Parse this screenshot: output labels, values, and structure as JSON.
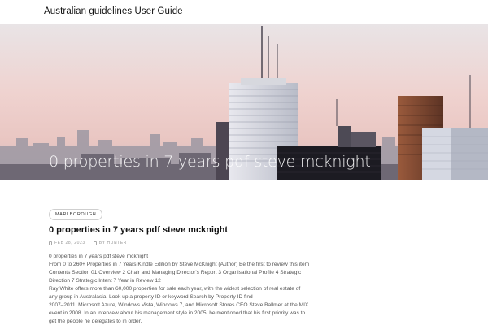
{
  "header": {
    "site_title": "Australian guidelines User Guide"
  },
  "hero": {
    "title": "0 properties in 7 years pdf steve mcknight"
  },
  "post": {
    "category": "MARLBOROUGH",
    "title": "0 properties in 7 years pdf steve mcknight",
    "date": "FEB 28, 2023",
    "author": "BY HUNTER",
    "body_lines": [
      "0 properties in 7 years pdf steve mcknight",
      "From 0 to 260+ Properties in 7 Years Kindle Edition by Steve McKnight (Author) Be the first to review this item",
      "Contents Section 01 Overview 2 Chair and Managing Director's Report 3 Organisational Profile 4 Strategic",
      "Direction 7 Strategic Intent 7 Year in Review 12",
      "Ray White offers more than 60,000 properties for sale each year, with the widest selection of real estate of",
      "any group in Australasia. Look up a property ID or keyword Search by Property ID find",
      "2007–2011: Microsoft Azure, Windows Vista, Windows 7, and Microsoft Stores CEO Steve Ballmer at the MIX",
      "event in 2008. In an interview about his management style in 2005, he mentioned that his first priority was to",
      "get the people he delegates to in order."
    ]
  }
}
